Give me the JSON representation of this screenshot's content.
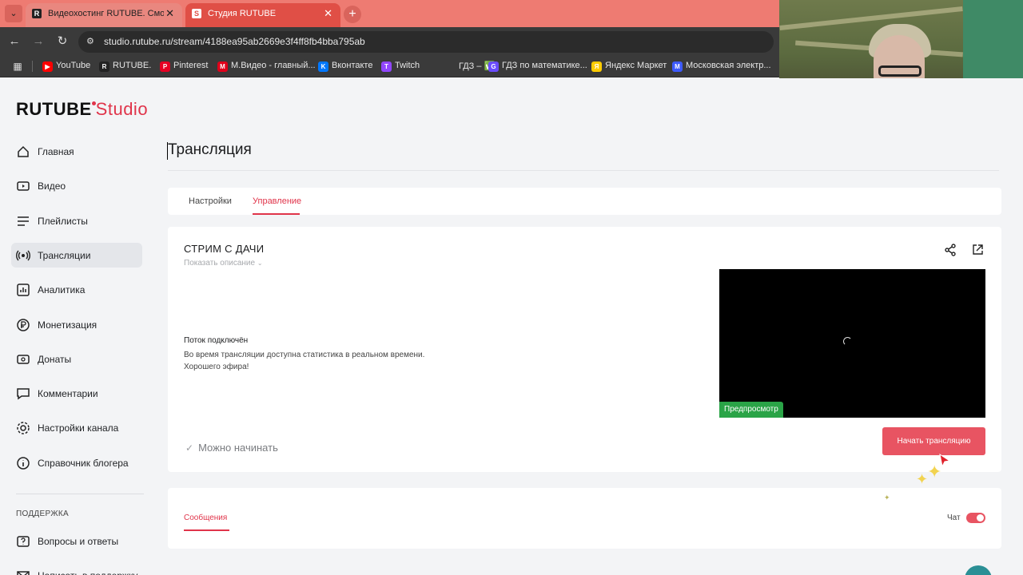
{
  "browser": {
    "tabs": [
      {
        "title": "Видеохостинг RUTUBE. Смотрите",
        "favicon": "R",
        "active": false
      },
      {
        "title": "Студия RUTUBE",
        "favicon": "S",
        "active": true
      }
    ],
    "url": "studio.rutube.ru/stream/4188ea95ab2669e3f4ff8fb4bba795ab",
    "bookmarks": [
      {
        "label": "YouTube",
        "color": "#ff0000",
        "glyph": "▶"
      },
      {
        "label": "RUTUBE.",
        "color": "#222222",
        "glyph": "R"
      },
      {
        "label": "Pinterest",
        "color": "#e60023",
        "glyph": "P"
      },
      {
        "label": "М.Видео - главный...",
        "color": "#e0001a",
        "glyph": "M"
      },
      {
        "label": "Вконтакте",
        "color": "#0077ff",
        "glyph": "K"
      },
      {
        "label": "Twitch",
        "color": "#9146ff",
        "glyph": "T"
      },
      {
        "label": "ГДЗ – ✅",
        "color": "#3a3a3a",
        "glyph": ""
      },
      {
        "label": "ГДЗ по математике...",
        "color": "#6a4cff",
        "glyph": "G"
      },
      {
        "label": "Яндекс Маркет",
        "color": "#ffcc00",
        "glyph": "Я"
      },
      {
        "label": "Московская электр...",
        "color": "#3d5afe",
        "glyph": "M"
      }
    ]
  },
  "brand": {
    "name": "RUTUBE",
    "suffix": "Studio",
    "accent": "#e0344a"
  },
  "sidebar": {
    "items": [
      {
        "label": "Главная",
        "icon": "home-icon"
      },
      {
        "label": "Видео",
        "icon": "video-icon"
      },
      {
        "label": "Плейлисты",
        "icon": "playlist-icon"
      },
      {
        "label": "Трансляции",
        "icon": "broadcast-icon",
        "active": true
      },
      {
        "label": "Аналитика",
        "icon": "analytics-icon"
      },
      {
        "label": "Монетизация",
        "icon": "ruble-icon"
      },
      {
        "label": "Донаты",
        "icon": "donate-icon"
      },
      {
        "label": "Комментарии",
        "icon": "comment-icon"
      },
      {
        "label": "Настройки канала",
        "icon": "gear-icon"
      },
      {
        "label": "Справочник блогера",
        "icon": "info-icon"
      }
    ],
    "section_title": "ПОДДЕРЖКА",
    "support_items": [
      {
        "label": "Вопросы и ответы",
        "icon": "question-icon"
      },
      {
        "label": "Написать в поддержку",
        "icon": "mail-icon"
      }
    ]
  },
  "page": {
    "title": "Трансляция",
    "tabs": [
      "Настройки",
      "Управление"
    ],
    "active_tab": 1
  },
  "stream": {
    "title": "СТРИМ С ДАЧИ",
    "show_description": "Показать описание",
    "status_heading": "Поток подключён",
    "status_lines": [
      "Во время трансляции доступна статистика в реальном времени.",
      "Хорошего эфира!"
    ],
    "ready_text": "Можно начинать",
    "preview_label": "Предпросмотр",
    "start_button": "Начать трансляцию"
  },
  "chat": {
    "messages_tab": "Сообщения",
    "chat_label": "Чат",
    "chat_enabled": true
  }
}
